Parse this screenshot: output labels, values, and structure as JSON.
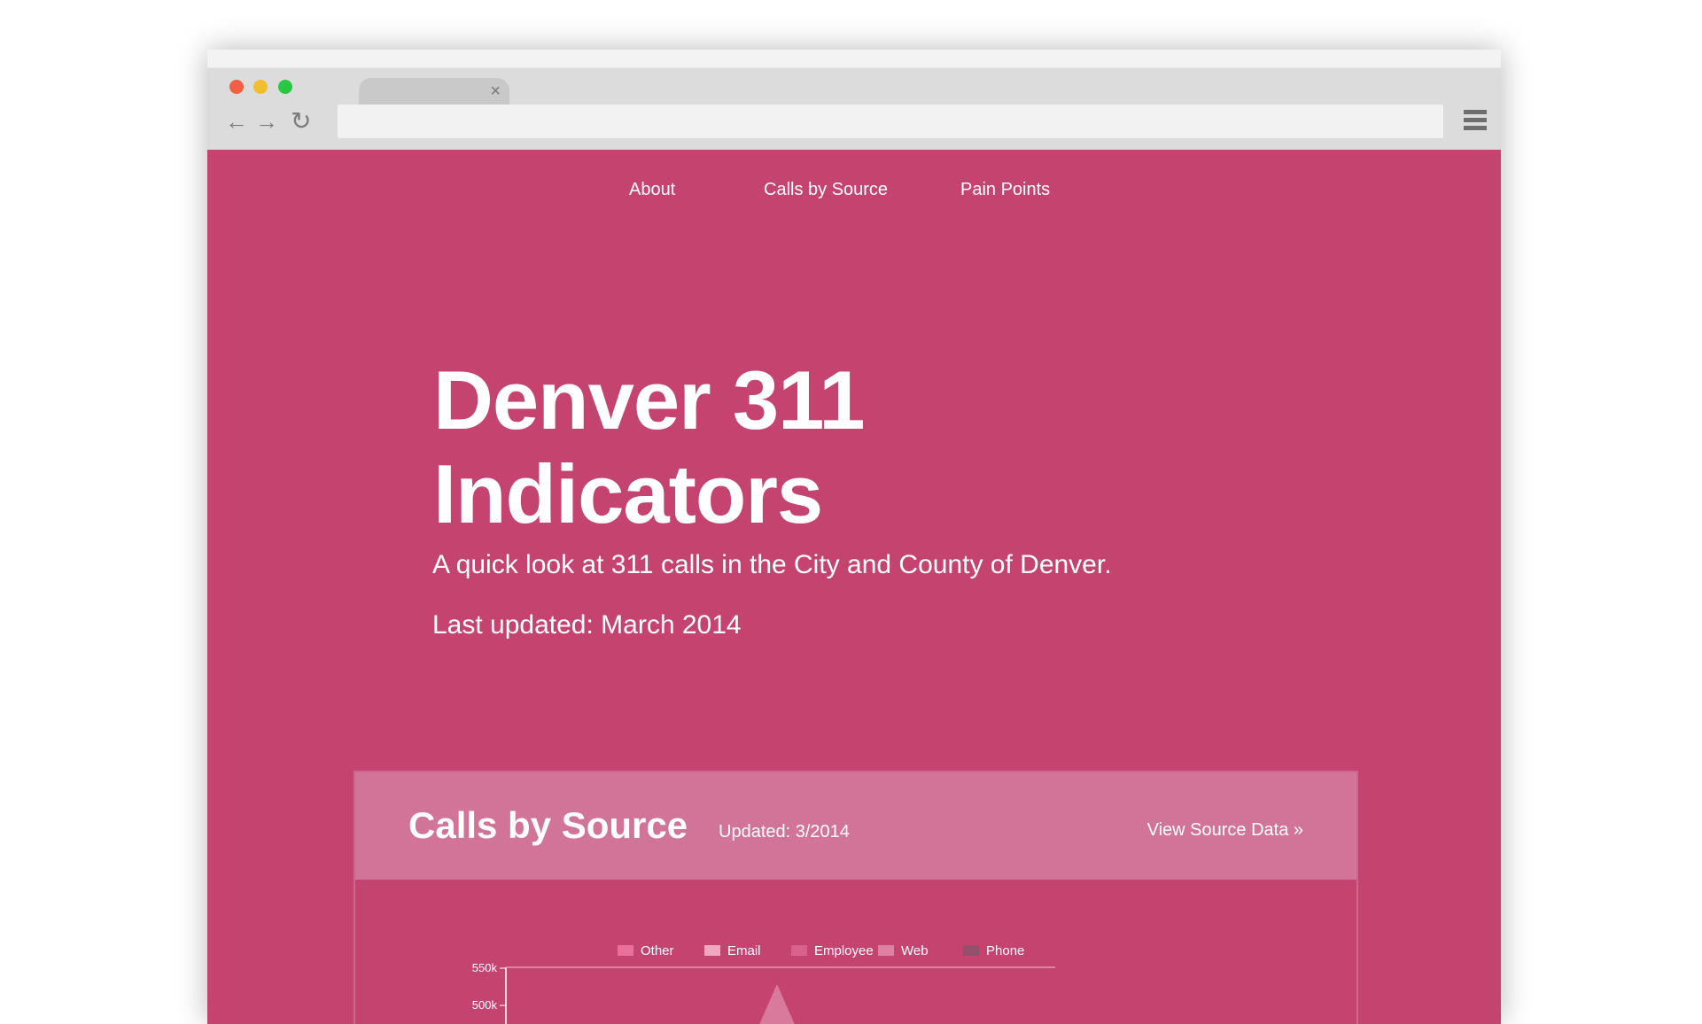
{
  "browser": {
    "tab_close": "×",
    "icons": {
      "back": "arrow-left-icon",
      "forward": "arrow-right-icon",
      "reload": "reload-icon",
      "menu": "hamburger-menu-icon"
    }
  },
  "nav": {
    "about": "About",
    "calls_by_source": "Calls by Source",
    "pain_points": "Pain Points"
  },
  "hero": {
    "title_line1": "Denver 311",
    "title_line2": "Indicators",
    "subtitle": "A quick look at 311 calls in the City and County of Denver.",
    "last_updated": "Last updated: March 2014"
  },
  "panel": {
    "title": "Calls by Source",
    "updated": "Updated: 3/2014",
    "link": "View Source Data »"
  },
  "chart_data": {
    "type": "area",
    "legend": [
      {
        "name": "Other",
        "color": "#e8709a"
      },
      {
        "name": "Email",
        "color": "#f1a7c0"
      },
      {
        "name": "Employee",
        "color": "#d9628c"
      },
      {
        "name": "Web",
        "color": "#df80a2"
      },
      {
        "name": "Phone",
        "color": "#94506a"
      }
    ],
    "y_ticks": [
      "550k",
      "500k"
    ]
  },
  "colors": {
    "page_background": "#c4436f",
    "panel_header": "#d17498"
  }
}
